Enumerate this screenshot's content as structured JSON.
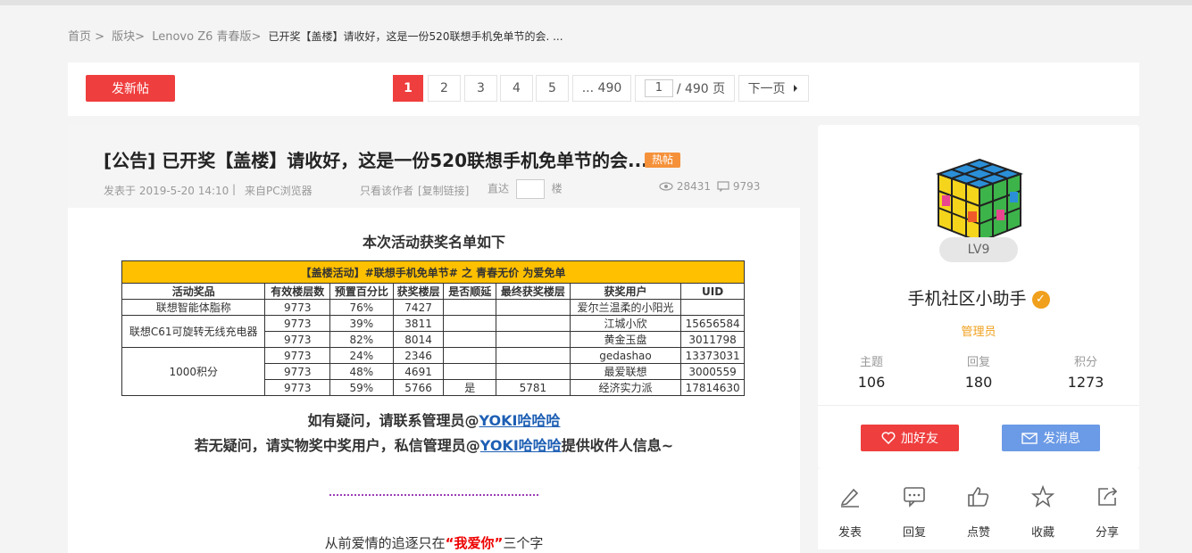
{
  "breadcrumb": {
    "home": "首页 >",
    "board": "版块>",
    "forum": "Lenovo Z6 青春版>",
    "current": "已开奖【盖楼】请收好，这是一份520联想手机免单节的会. ..."
  },
  "toolbar": {
    "new_post": "发新帖",
    "pages": [
      "1",
      "2",
      "3",
      "4",
      "5",
      "... 490"
    ],
    "page_input": "1",
    "page_total": "/ 490 页",
    "next": "下一页"
  },
  "post": {
    "title": "[公告] 已开奖【盖楼】请收好，这是一份520联想手机免单节的会...",
    "hot_badge": "热帖",
    "posted": "发表于 2019-5-20 14:10",
    "sep": "|",
    "source": "来自PC浏览器",
    "only_author": "只看该作者",
    "copy_link": "[复制链接]",
    "goto": "直达",
    "floor": "楼",
    "views": "28431",
    "replies": "9793",
    "content_heading": "本次活动获奖名单如下",
    "table": {
      "title": "【盖楼活动】#联想手机免单节# 之 青春无价 为爱免单",
      "headers": [
        "活动奖品",
        "有效楼层数",
        "预置百分比",
        "获奖楼层",
        "是否顺延",
        "最终获奖楼层",
        "获奖用户",
        "UID"
      ],
      "prizes": [
        "联想智能体脂称",
        "联想C61可旋转无线充电器",
        "1000积分"
      ],
      "rows": [
        [
          "9773",
          "76%",
          "7427",
          "",
          "",
          "爱尔兰温柔的小阳光",
          ""
        ],
        [
          "9773",
          "39%",
          "3811",
          "",
          "",
          "江城小欣",
          "15656584"
        ],
        [
          "9773",
          "82%",
          "8014",
          "",
          "",
          "黄金玉盘",
          "3011798"
        ],
        [
          "9773",
          "24%",
          "2346",
          "",
          "",
          "gedashao",
          "13373031"
        ],
        [
          "9773",
          "48%",
          "4691",
          "",
          "",
          "最爱联想",
          "3000559"
        ],
        [
          "9773",
          "59%",
          "5766",
          "是",
          "5781",
          "经济实力派",
          "17814630"
        ]
      ]
    },
    "line1_text": "如有疑问，请联系管理员@",
    "admin_link": "YOKI哈哈哈",
    "line2_text": "若无疑问，请实物奖中奖用户，私信管理员@",
    "line2_tail": "提供收件人信息~",
    "line3_pre": "从前爱情的追逐只在",
    "line3_em": "“我爱你”",
    "line3_post": "三个字"
  },
  "author": {
    "level": "LV9",
    "name": "手机社区小助手",
    "role": "管理员",
    "stats": [
      {
        "label": "主题",
        "value": "106"
      },
      {
        "label": "回复",
        "value": "180"
      },
      {
        "label": "积分",
        "value": "1273"
      }
    ],
    "add_friend": "加好友",
    "message": "发消息"
  },
  "actions": [
    "发表",
    "回复",
    "点赞",
    "收藏",
    "分享"
  ],
  "colors": {
    "accent": "#ef3e3e",
    "gold": "#f0a01c",
    "blue_btn": "#6b9ae6",
    "hot": "#f5913a"
  }
}
